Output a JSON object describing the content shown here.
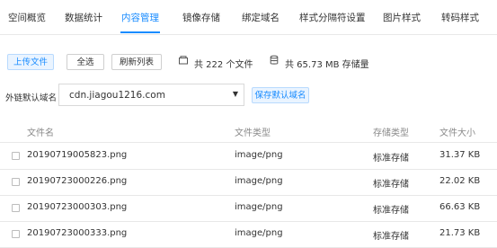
{
  "tabs": [
    {
      "label": "空间概览"
    },
    {
      "label": "数据统计"
    },
    {
      "label": "内容管理",
      "active": true
    },
    {
      "label": "镜像存储"
    },
    {
      "label": "绑定域名"
    },
    {
      "label": "样式分隔符设置"
    },
    {
      "label": "图片样式"
    },
    {
      "label": "转码样式"
    }
  ],
  "toolbar": {
    "upload_label": "上传文件",
    "select_all_label": "全选",
    "refresh_label": "刷新列表",
    "file_count_text": "共 222 个文件",
    "storage_text": "共 65.73 MB 存储量"
  },
  "domain": {
    "label": "外链默认域名",
    "value": "cdn.jiagou1216.com",
    "save_label": "保存默认域名"
  },
  "table": {
    "headers": [
      "文件名",
      "文件类型",
      "存储类型",
      "文件大小"
    ],
    "rows": [
      {
        "name": "20190719005823.png",
        "type": "image/png",
        "storage": "标准存储",
        "size": "31.37 KB"
      },
      {
        "name": "20190723000226.png",
        "type": "image/png",
        "storage": "标准存储",
        "size": "22.02 KB"
      },
      {
        "name": "20190723000303.png",
        "type": "image/png",
        "storage": "标准存储",
        "size": "66.63 KB"
      },
      {
        "name": "20190723000333.png",
        "type": "image/png",
        "storage": "标准存储",
        "size": "21.73 KB"
      }
    ]
  },
  "colors": {
    "accent": "#1a8cff",
    "border": "#e8e8e8",
    "muted": "#8a8a8a"
  }
}
